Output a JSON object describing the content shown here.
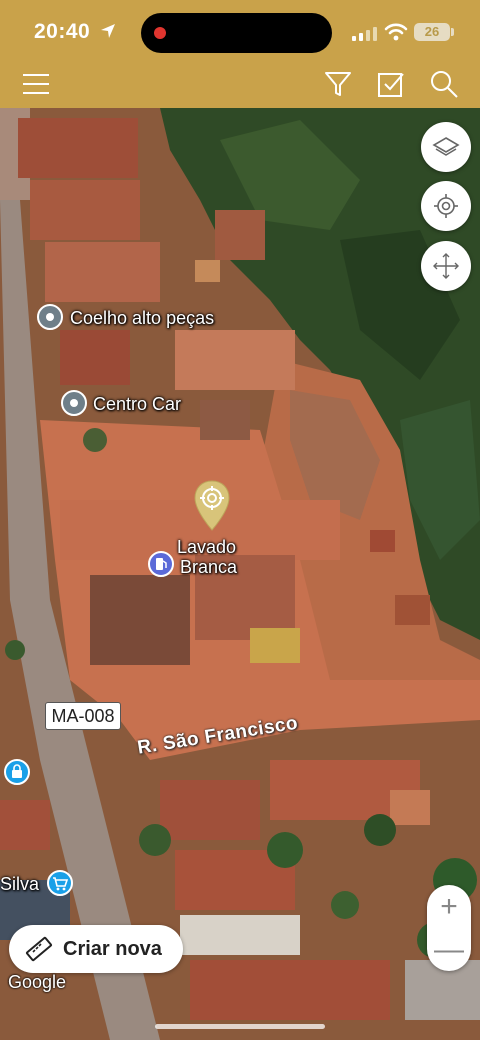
{
  "status_bar": {
    "time": "20:40",
    "battery": "26"
  },
  "app_bar": {
    "icons": [
      "menu-icon",
      "filter-icon",
      "checkbox-icon",
      "search-icon"
    ],
    "background": "#c9a24a"
  },
  "map": {
    "pois": [
      {
        "label": "Coelho alto peças"
      },
      {
        "label": "Centro Car"
      },
      {
        "label_line1": "Lavado",
        "label_line2": "Branca"
      },
      {
        "label": "Silva"
      }
    ],
    "road_badge": "MA-008",
    "street_label": "R. São Francisco",
    "attribution": "Google",
    "zoom_in": "+",
    "zoom_out": "—"
  },
  "controls": {
    "create_button": "Criar nova",
    "side_buttons": [
      "layers-icon",
      "my-location-icon",
      "move-icon"
    ]
  }
}
